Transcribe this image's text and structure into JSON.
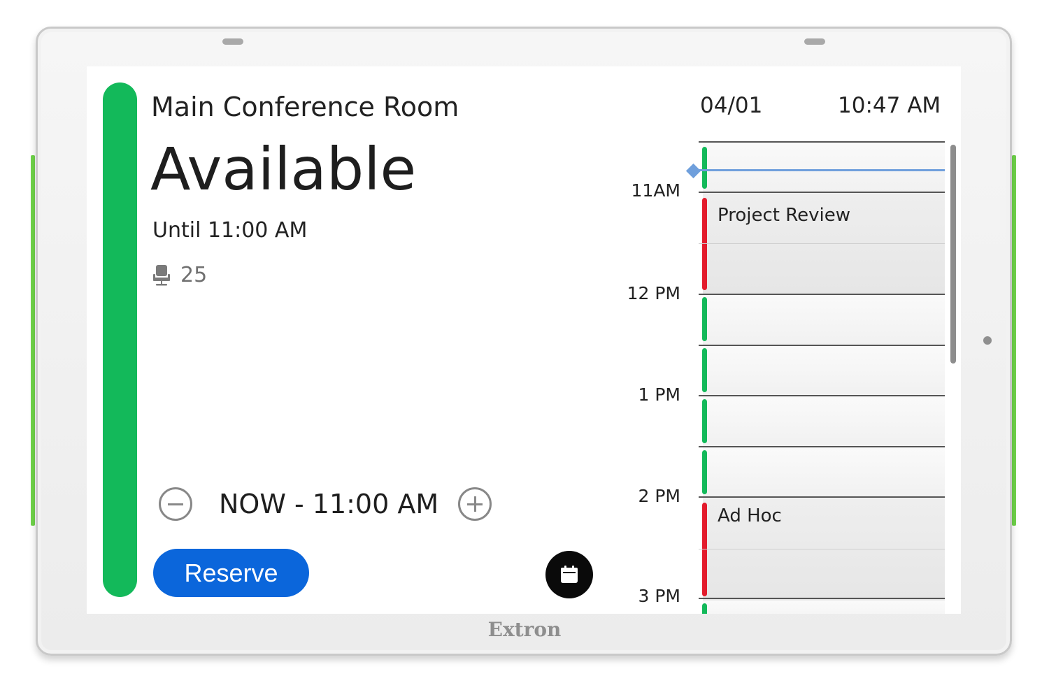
{
  "room": {
    "name": "Main Conference Room",
    "status": "Available",
    "until": "Until 11:00 AM",
    "capacity": "25"
  },
  "header": {
    "date": "04/01",
    "time": "10:47 AM"
  },
  "booking": {
    "duration": "NOW - 11:00 AM",
    "reserve_label": "Reserve"
  },
  "schedule": {
    "time_labels": [
      "11AM",
      "12 PM",
      "1 PM",
      "2 PM",
      "3 PM"
    ],
    "events": [
      {
        "title": "Project Review"
      },
      {
        "title": "Ad Hoc"
      }
    ]
  },
  "device": {
    "brand": "Extron"
  },
  "colors": {
    "available": "#13b95a",
    "booked": "#e31b2c",
    "reserve": "#0b66db",
    "now_line": "#6f9fdc",
    "side_led": "#6fd34a"
  }
}
